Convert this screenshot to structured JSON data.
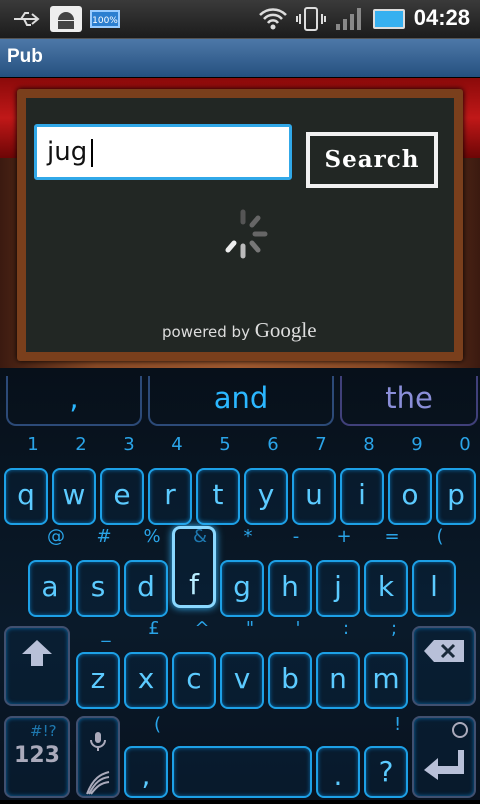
{
  "status_bar": {
    "battery_label": "100%",
    "time": "04:28",
    "icons": [
      "usb-icon",
      "android-debug-icon",
      "battery-100-icon",
      "wifi-icon",
      "vibrate-icon",
      "signal-icon",
      "battery-icon"
    ]
  },
  "app": {
    "title": "Pub"
  },
  "search": {
    "query": "jug",
    "button_label": "Search",
    "powered_by": "powered by",
    "google": "Google"
  },
  "keyboard": {
    "suggestions": [
      ",",
      "and",
      "the"
    ],
    "row1_hints": [
      "1",
      "2",
      "3",
      "4",
      "5",
      "6",
      "7",
      "8",
      "9",
      "0"
    ],
    "row1_keys": [
      "q",
      "w",
      "e",
      "r",
      "t",
      "y",
      "u",
      "i",
      "o",
      "p"
    ],
    "row2_hints": [
      "@",
      "#",
      "%",
      "&",
      "*",
      "-",
      "+",
      "=",
      "("
    ],
    "row2_keys": [
      "a",
      "s",
      "d",
      "f",
      "g",
      "h",
      "j",
      "k",
      "l"
    ],
    "row3_hints": [
      "_",
      "£",
      "^",
      "\"",
      "'",
      ":",
      ";"
    ],
    "row3_keys": [
      "z",
      "x",
      "c",
      "v",
      "b",
      "n",
      "m"
    ],
    "row4_hints": [
      "#!?",
      "(",
      "!"
    ],
    "symbols_label": "123",
    "comma": ",",
    "period": ".",
    "question": "?"
  }
}
